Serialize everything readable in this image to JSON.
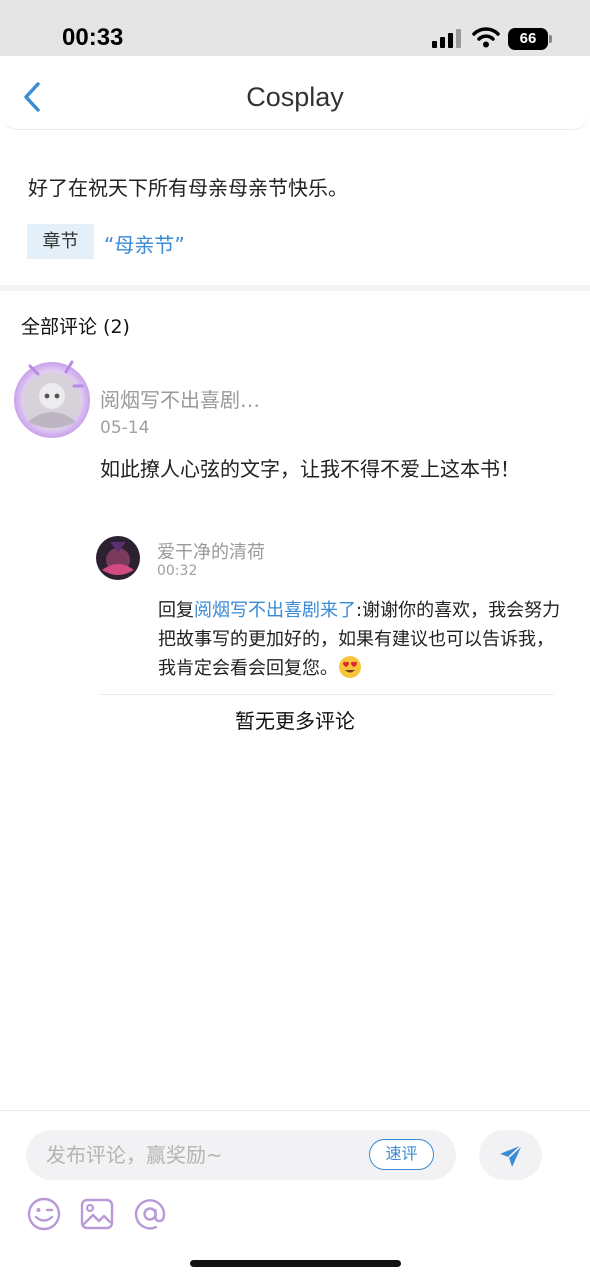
{
  "status_bar": {
    "time": "00:33",
    "battery": "66"
  },
  "nav": {
    "title": "Cosplay"
  },
  "post": {
    "text": "好了在祝天下所有母亲母亲节快乐。",
    "tag_label": "章节",
    "tag_value": "“母亲节”"
  },
  "comments_header": "全部评论 (2)",
  "comment": {
    "author": "阅烟写不出喜剧…",
    "date": "05-14",
    "body": "如此撩人心弦的文字，让我不得不爱上这本书！",
    "reply": {
      "author": "爱干净的清荷",
      "time": "00:32",
      "prefix": "回复",
      "mention": "阅烟写不出喜剧来了",
      "text": ":谢谢你的喜欢，我会努力把故事写的更加好的，如果有建议也可以告诉我，我肯定会看会回复您。"
    }
  },
  "no_more": "暂无更多评论",
  "bottom": {
    "input_placeholder": "发布评论，赢奖励~",
    "quick_label": "速评"
  },
  "colors": {
    "accent": "#3a8ad6",
    "icon_purple": "#b99ad8"
  }
}
